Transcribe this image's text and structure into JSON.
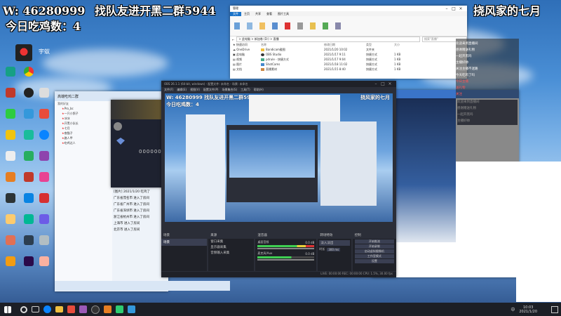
{
  "overlay": {
    "line1_prefix": "W:",
    "line1_qq": "46280999",
    "line1_group": "找队友进开黑二群5944",
    "line2": "今日吃鸡数：4",
    "top_right": "挠风家的七月"
  },
  "obs": {
    "title": "OBS 26.1.1 (64-bit, windows) - 配置文件: 未命名 - 场景: 未命名",
    "menu": [
      "文件(F)",
      "编辑(E)",
      "视图(V)",
      "配置文件(P)",
      "场景集合(S)",
      "工具(T)",
      "帮助(H)"
    ],
    "preview_overlay_line1": "W: 46280999  找队友进开黑二群5944",
    "preview_overlay_line2": "今日吃鸡数：4",
    "preview_top_right": "挠风家的七月",
    "docks": {
      "scenes": "场景",
      "sources": "来源",
      "mixer": "混音器",
      "transitions": "转场特效",
      "controls": "控制"
    },
    "scene_items": [
      "场景"
    ],
    "source_items": [
      "窗口采集",
      "显示器采集",
      "音频输入采集"
    ],
    "mixer_channels": [
      "桌面音频",
      "麦克风/Aux"
    ],
    "mixer_db": [
      "0.0 dB",
      "0.0 dB"
    ],
    "transition_value": "淡入淡出",
    "duration_label": "时长",
    "duration_value": "300 ms",
    "control_buttons": [
      "开始推流",
      "开始录制",
      "启动虚拟摄像机",
      "工作室模式",
      "设置",
      "退出"
    ],
    "status": "LIVE: 00:00:00   REC: 00:00:00   CPU: 1.5%, 30.00 fps"
  },
  "explorer": {
    "title": "管理",
    "tabs": [
      "文件",
      "主页",
      "共享",
      "查看",
      "图片工具"
    ],
    "address": "> 此电脑 > 新加卷 (D:) > 直播",
    "search_placeholder": "搜索\"直播\"",
    "columns": [
      "名称",
      "修改日期",
      "类型",
      "大小"
    ],
    "files": [
      {
        "name": "Bandicam截图",
        "date": "2021/1/20 10:02",
        "type": "文件夹",
        "size": ""
      },
      {
        "name": "OBS Studio",
        "date": "2021/1/17 9:11",
        "type": "快捷方式",
        "size": "1 KB"
      },
      {
        "name": "pdrule - 快捷方式",
        "date": "2021/1/17 9:04",
        "type": "快捷方式",
        "size": "1 KB"
      },
      {
        "name": "ShotCams",
        "date": "2021/1/18 11:02",
        "type": "快捷方式",
        "size": "1 KB"
      },
      {
        "name": "直播素材",
        "date": "2021/1/15 8:40",
        "type": "快捷方式",
        "size": "1 KB"
      }
    ],
    "status_text": "5 个项目"
  },
  "qq_group": {
    "title": "高端吃鸡二群",
    "header": "我的好友",
    "members": [
      "Pro_bc",
      "一只小鸽子",
      "冰冰",
      "开黑小队长",
      "七月",
      "夜猫子",
      "路人甲",
      "吃鸡达人"
    ],
    "chat_lines": [
      "[图片] 2021/1/20 吃鸡了",
      "广东省茂名市 进入了房间",
      "广东省广州市 进入了房间",
      "广东省深圳市 进入了房间",
      "浙江省杭州市 进入了房间",
      "上海市 进入了房间",
      "北京市 进入了房间"
    ],
    "input_hint": "说点什么吧..."
  },
  "stream_room": {
    "user_level": "0000000",
    "right_chat": [
      "欢迎来到直播间",
      "感谢赠送礼物",
      "一起开黑吗",
      "主播好帅",
      "关注主播不迷路",
      "今天吃鸡了吗"
    ],
    "right_badges": [
      "今日主播",
      "送礼物",
      "关注"
    ],
    "follow_button": "关注"
  },
  "taskbar": {
    "time": "10:03",
    "date": "2021/1/20",
    "lang": "中"
  },
  "colors": {
    "obs_bg": "#2b2e38",
    "obs_panel": "#1f2128",
    "accent_orange": "#f27a1a",
    "taskbar": "#1c1f26",
    "meter_green": "#3fcf52"
  }
}
